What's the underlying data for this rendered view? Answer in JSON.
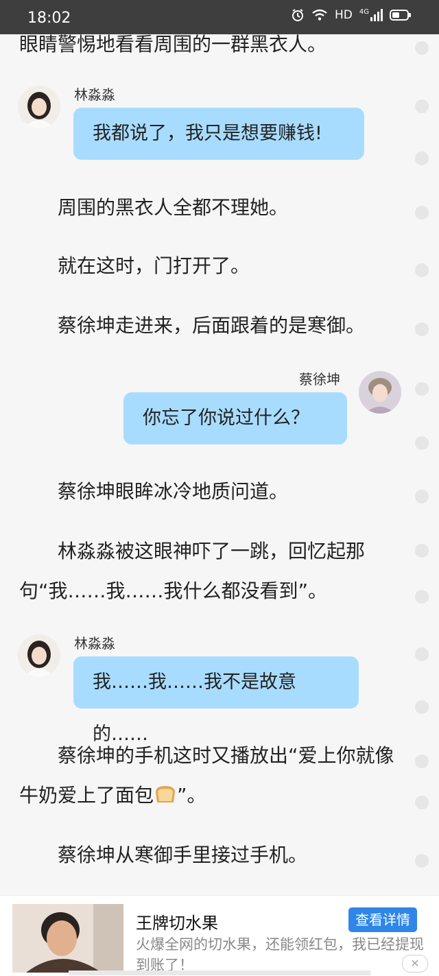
{
  "status_bar": {
    "time": "18:02",
    "hd": "HD",
    "network": "4G",
    "icons": [
      "alarm-icon",
      "wifi-icon",
      "signal-icon",
      "battery-icon"
    ]
  },
  "story": {
    "para_top": "眼睛警惕地看看周围的一群黑衣人。",
    "msg1": {
      "name": "林淼淼",
      "text": "我都说了，我只是想要赚钱!"
    },
    "para2": "周围的黑衣人全都不理她。",
    "para3": "就在这时，门打开了。",
    "para4": "蔡徐坤走进来，后面跟着的是寒御。",
    "msg2": {
      "name": "蔡徐坤",
      "text": "你忘了你说过什么？"
    },
    "para5": "蔡徐坤眼眸冰冷地质问道。",
    "para6": "林淼淼被这眼神吓了一跳，回忆起那句“我……我……我什么都没看到”。",
    "msg3": {
      "name": "林淼淼",
      "text": "我……我……我不是故意的……"
    },
    "para7": "蔡徐坤的手机这时又播放出“爱上你就像牛奶爱上了面包",
    "para7_end": "”。",
    "para8": "蔡徐坤从寒御手里接过手机。"
  },
  "ad": {
    "title": "王牌切水果",
    "description": "火爆全网的切水果，还能领红包，我已经提现到账了！",
    "button": "查看详情",
    "close": "✕"
  },
  "colors": {
    "bubble": "#a8dcff",
    "status_bar": "#3e3e3e",
    "ad_button": "#2f86e8"
  }
}
